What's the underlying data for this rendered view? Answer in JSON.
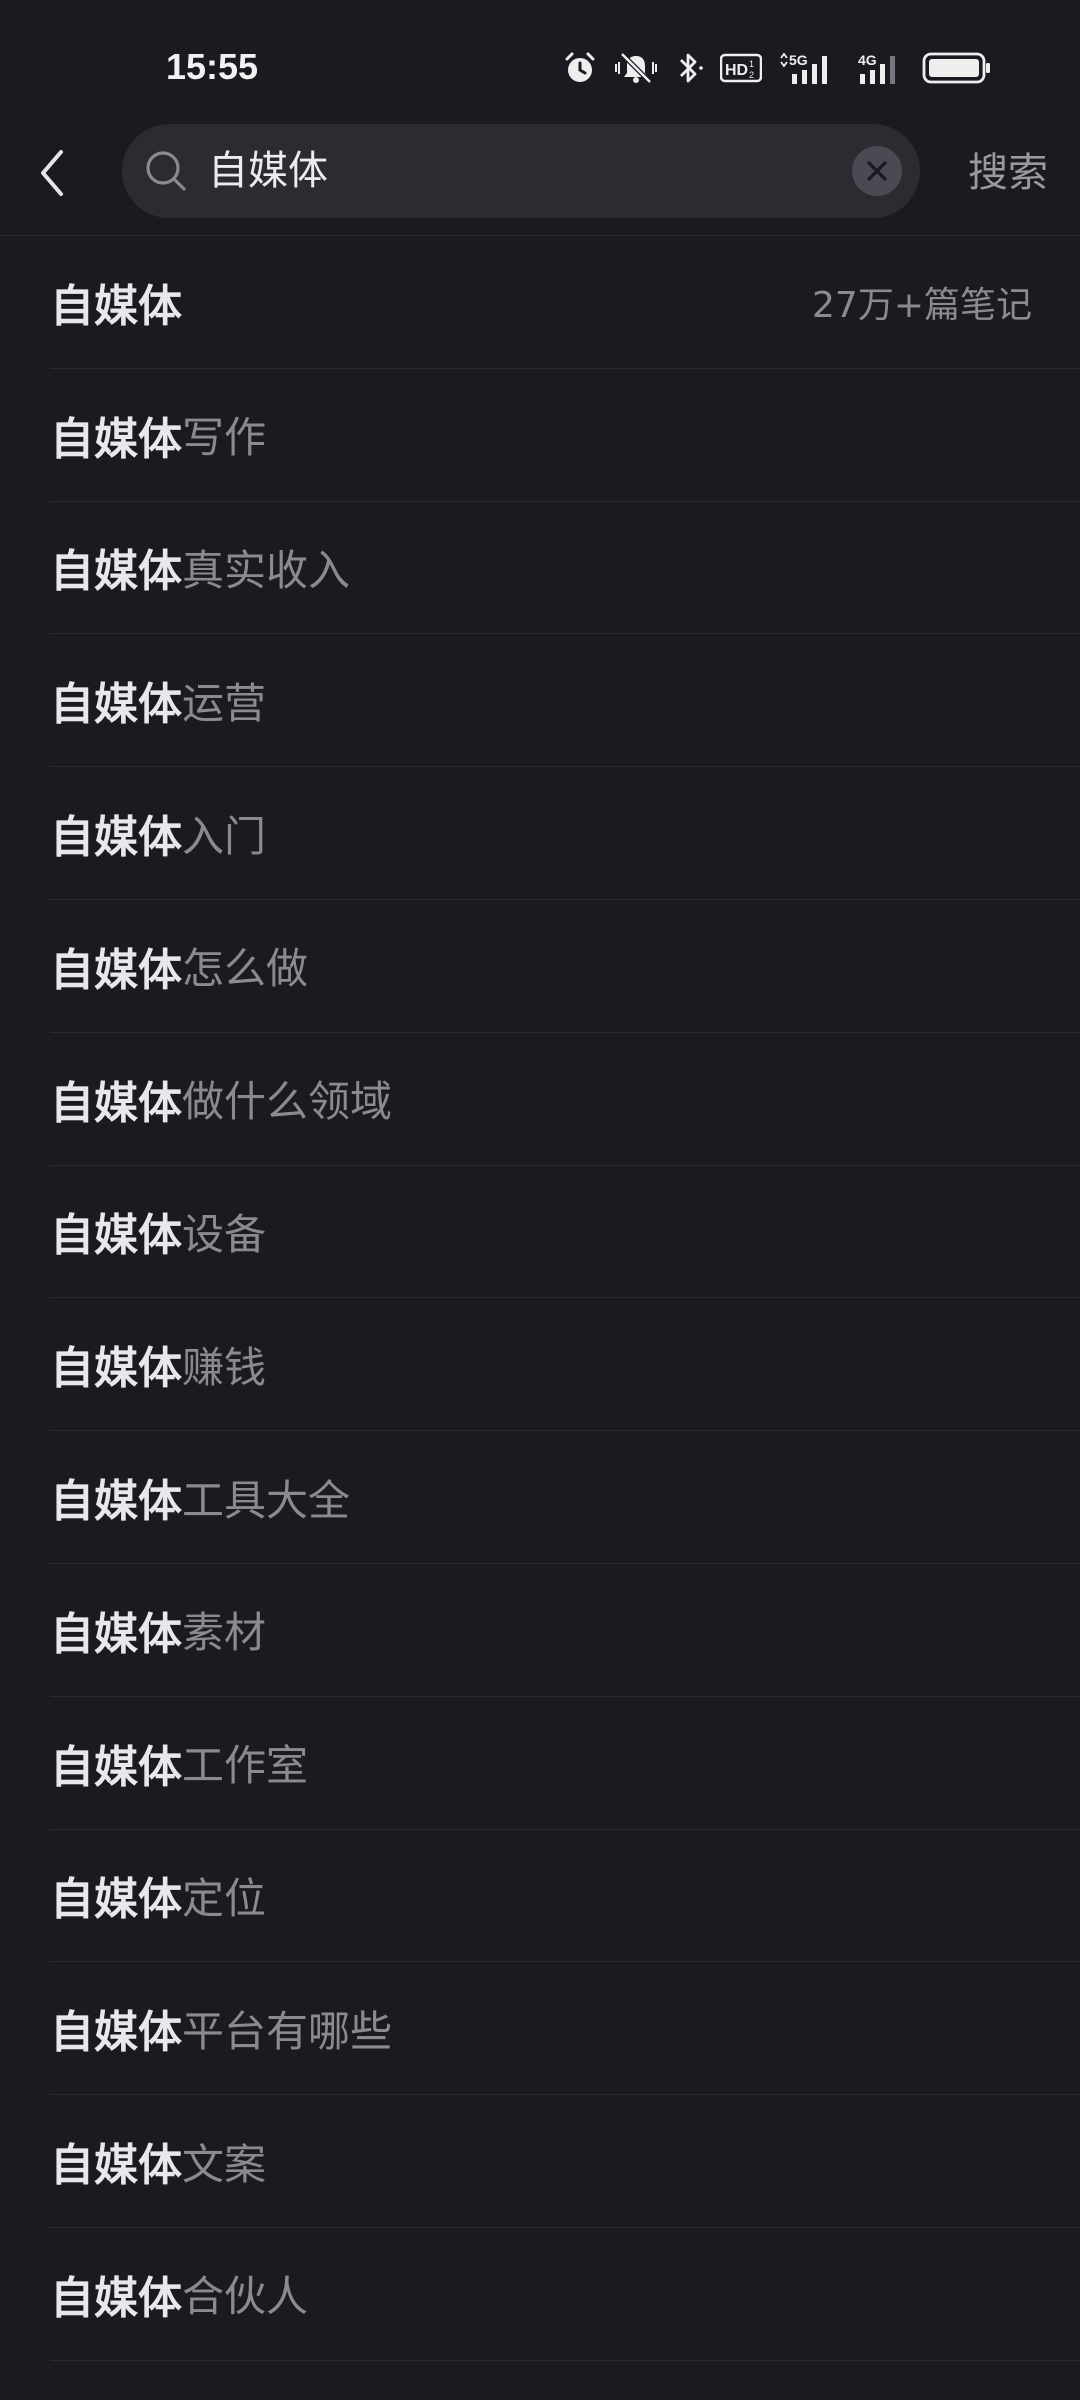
{
  "status_bar": {
    "time": "15:55",
    "network_5g": "5G",
    "network_4g": "4G",
    "hd_label": "HD"
  },
  "search": {
    "query": "自媒体",
    "submit_label": "搜索"
  },
  "suggestions": [
    {
      "keyword": "自媒体",
      "suffix": "",
      "count": "27万+篇笔记"
    },
    {
      "keyword": "自媒体",
      "suffix": "写作"
    },
    {
      "keyword": "自媒体",
      "suffix": "真实收入"
    },
    {
      "keyword": "自媒体",
      "suffix": "运营"
    },
    {
      "keyword": "自媒体",
      "suffix": "入门"
    },
    {
      "keyword": "自媒体",
      "suffix": "怎么做"
    },
    {
      "keyword": "自媒体",
      "suffix": "做什么领域"
    },
    {
      "keyword": "自媒体",
      "suffix": "设备"
    },
    {
      "keyword": "自媒体",
      "suffix": "赚钱"
    },
    {
      "keyword": "自媒体",
      "suffix": "工具大全"
    },
    {
      "keyword": "自媒体",
      "suffix": "素材"
    },
    {
      "keyword": "自媒体",
      "suffix": "工作室"
    },
    {
      "keyword": "自媒体",
      "suffix": "定位"
    },
    {
      "keyword": "自媒体",
      "suffix": "平台有哪些"
    },
    {
      "keyword": "自媒体",
      "suffix": "文案"
    },
    {
      "keyword": "自媒体",
      "suffix": "合伙人"
    }
  ]
}
